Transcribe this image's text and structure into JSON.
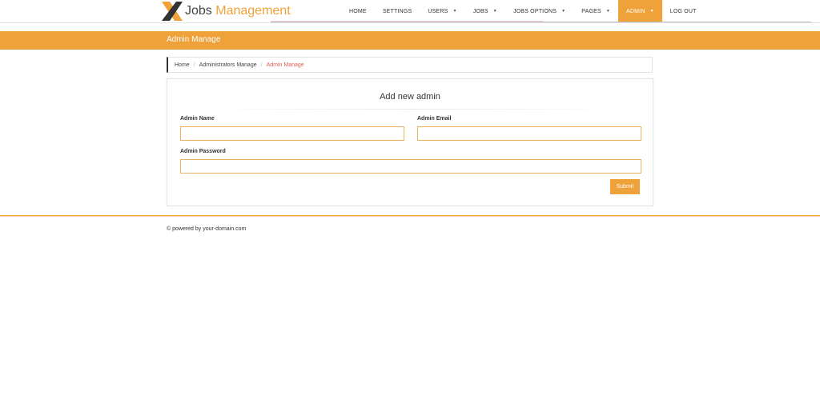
{
  "brand": {
    "part1": "Jobs",
    "part2": " Management"
  },
  "nav": {
    "items": [
      {
        "label": "HOME",
        "has_caret": false,
        "active": false
      },
      {
        "label": "SETTINGS",
        "has_caret": false,
        "active": false
      },
      {
        "label": "USERS",
        "has_caret": true,
        "active": false
      },
      {
        "label": "JOBS",
        "has_caret": true,
        "active": false
      },
      {
        "label": "JOBS OPTIONS",
        "has_caret": true,
        "active": false
      },
      {
        "label": "PAGES",
        "has_caret": true,
        "active": false
      },
      {
        "label": "ADMIN",
        "has_caret": true,
        "active": true
      },
      {
        "label": "LOG OUT",
        "has_caret": false,
        "active": false
      }
    ],
    "caret_glyph": "▼"
  },
  "page_title": "Admin Manage",
  "breadcrumb": {
    "home": "Home",
    "parent": "Administrators Manage",
    "current": "Admin Manage",
    "separator": "/"
  },
  "form": {
    "title": "Add new admin",
    "name_label": "Admin Name",
    "name_value": "",
    "email_label": "Admin Email",
    "email_value": "",
    "password_label": "Admin Password",
    "password_value": "",
    "submit_label": "Submit"
  },
  "footer": {
    "text": "© powered by your-domain.com"
  },
  "colors": {
    "accent": "#f0a23a",
    "breadcrumb_current": "#e06050"
  }
}
